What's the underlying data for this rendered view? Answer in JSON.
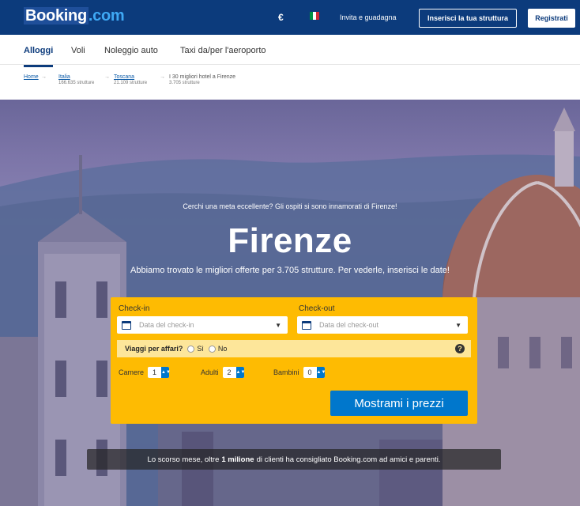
{
  "header": {
    "logo_part1": "Booking",
    "logo_part2": ".com",
    "currency": "€",
    "flag_colors": [
      "#009246",
      "#ffffff",
      "#ce2b37"
    ],
    "invite_label": "Invita e guadagna",
    "list_property_label": "Inserisci la tua struttura",
    "register_label": "Registrati"
  },
  "nav": {
    "tabs": [
      {
        "label": "Alloggi",
        "active": true
      },
      {
        "label": "Voli",
        "active": false
      },
      {
        "label": "Noleggio auto",
        "active": false
      },
      {
        "label": "Taxi da/per l'aeroporto",
        "active": false
      }
    ]
  },
  "breadcrumb": {
    "items": [
      {
        "label": "Home",
        "sub": ""
      },
      {
        "label": "Italia",
        "sub": "166.635 strutture"
      },
      {
        "label": "Toscana",
        "sub": "21.109 strutture"
      },
      {
        "label": "I 30 migliori hotel a Firenze",
        "sub": "3.705 strutture"
      }
    ],
    "separator": "→"
  },
  "hero": {
    "tagline": "Cerchi una meta eccellente? Gli ospiti si sono innamorati di Firenze!",
    "city": "Firenze",
    "subtitle": "Abbiamo trovato le migliori offerte per 3.705 strutture. Per vederle, inserisci le date!"
  },
  "search": {
    "checkin_label": "Check-in",
    "checkin_placeholder": "Data del check-in",
    "checkout_label": "Check-out",
    "checkout_placeholder": "Data del check-out",
    "business_question": "Viaggi per affari?",
    "business_yes": "Sì",
    "business_no": "No",
    "help_icon": "?",
    "rooms_label": "Camere",
    "rooms_value": "1",
    "adults_label": "Adulti",
    "adults_value": "2",
    "children_label": "Bambini",
    "children_value": "0",
    "submit_label": "Mostrami i prezzi",
    "accent_color": "#febb02",
    "button_color": "#0077cc"
  },
  "footer_message": {
    "before": "Lo scorso mese, oltre",
    "bold": "1 milione",
    "after": "di clienti ha consigliato Booking.com ad amici e parenti."
  }
}
